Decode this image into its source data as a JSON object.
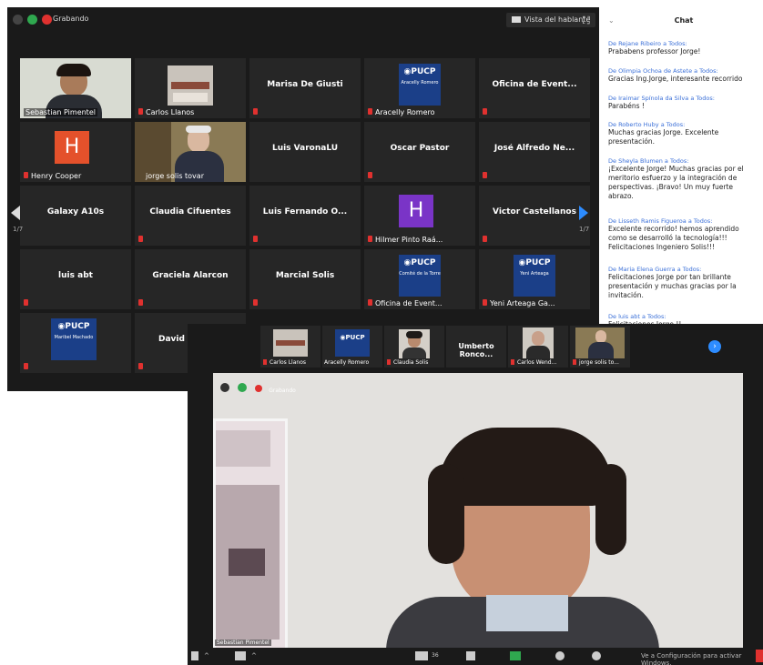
{
  "gallery": {
    "recording_label": "Grabando",
    "speaker_view_label": "Vista del hablante",
    "page_left": "1/7",
    "page_right": "1/7",
    "tiles": [
      {
        "name": "Sebastian Pimentel",
        "type": "video-sebastian"
      },
      {
        "name": "Carlos Llanos",
        "type": "video-room"
      },
      {
        "name": "Marisa De Giusti",
        "type": "name"
      },
      {
        "name": "Aracelly Romero",
        "type": "pucp",
        "card_text": "Aracelly Romero"
      },
      {
        "name": "Oficina de Event...",
        "type": "name"
      },
      {
        "name": "Henry Cooper",
        "type": "h",
        "color": "#e4512b"
      },
      {
        "name": "jorge solis tovar",
        "type": "video-jorge"
      },
      {
        "name": "Luis VaronaLU",
        "type": "name"
      },
      {
        "name": "Oscar Pastor",
        "type": "name"
      },
      {
        "name": "José Alfredo Ne...",
        "type": "name"
      },
      {
        "name": "Galaxy A10s",
        "type": "name"
      },
      {
        "name": "Claudia Cifuentes",
        "type": "name"
      },
      {
        "name": "Luis Fernando O...",
        "type": "name"
      },
      {
        "name": "Hilmer Pinto Raá...",
        "type": "h",
        "color": "#7a34c7"
      },
      {
        "name": "Victor Castellanos",
        "type": "name"
      },
      {
        "name": "luis abt",
        "type": "name"
      },
      {
        "name": "Graciela Alarcon",
        "type": "name"
      },
      {
        "name": "Marcial Solis",
        "type": "name"
      },
      {
        "name": "Oficina de Event...",
        "type": "pucp",
        "card_text": "Comité de la Torre"
      },
      {
        "name": "Yeni Arteaga Ga...",
        "type": "pucp",
        "card_text": "Yeni Arteaga"
      },
      {
        "name": "",
        "type": "pucp",
        "card_text": "Maribel Machado"
      },
      {
        "name": "David",
        "type": "name"
      }
    ]
  },
  "chat": {
    "title": "Chat",
    "messages": [
      {
        "from": "De Rejane Ribeiro a Todos:",
        "text": "Prababens professor Jorge!"
      },
      {
        "from": "De Olimpia Ochoa de Astete a Todos:",
        "text": "Gracias Ing.Jorge, interesante recorrido"
      },
      {
        "from": "De Iraimar Spínola da Silva a Todos:",
        "text": "Parabéns !"
      },
      {
        "from": "De Roberto Huby a Todos:",
        "text": "Muchas gracias Jorge. Excelente presentación."
      },
      {
        "from": "De Sheyla Blumen a Todos:",
        "text": "¡Excelente Jorge! Muchas gracias por el meritorio esfuerzo y la integración de perspectivas. ¡Bravo! Un muy fuerte abrazo."
      },
      {
        "from": "De Lisseth Ramis Figueroa a Todos:",
        "text": "Excelente recorrido! hemos aprendido como se desarrolló la tecnología!!! Felicitaciones Ingeniero Solis!!!"
      },
      {
        "from": "De Maria Elena Guerra a Todos:",
        "text": "Felicitaciones Jorge por tan brillante presentación y muchas gracias por la invitación."
      },
      {
        "from": "De luis abt a Todos:",
        "text": "Felicitaciones Jorge !!"
      }
    ]
  },
  "speaker": {
    "strip": [
      {
        "name": "Carlos Llanos",
        "type": "video-room"
      },
      {
        "name": "Aracelly Romero",
        "type": "pucp"
      },
      {
        "name": "Claudia Solis",
        "type": "video-woman"
      },
      {
        "name": "Umberto Ronco...",
        "type": "name"
      },
      {
        "name": "Carlos Wend...",
        "type": "video-man"
      },
      {
        "name": "jorge solis to...",
        "type": "video-jorge"
      }
    ],
    "video_label": "Sebastian Pimentel",
    "recording_label": "Grabando",
    "activate_windows": "Ve a Configuración para activar Windows.",
    "participants_count": "36"
  },
  "colors": {
    "zoom_bg": "#1a1a1a",
    "tile_bg": "#262626",
    "active_border": "#b6e23a",
    "pucp_blue": "#1b3f88",
    "chat_from": "#3a6fd8",
    "nav_blue": "#2d8cff"
  }
}
